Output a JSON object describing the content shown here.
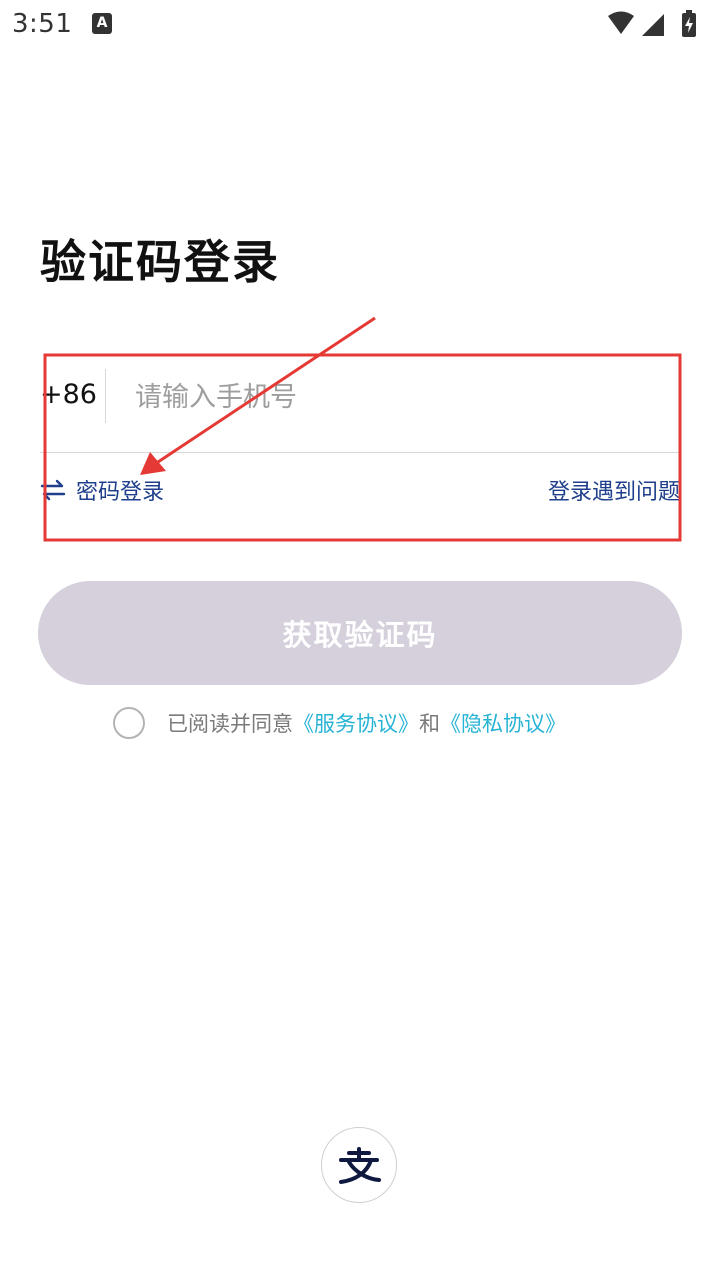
{
  "status_bar": {
    "time": "3:51",
    "notification_letter": "A",
    "icons": [
      "wifi-icon",
      "cellular-signal-icon",
      "battery-charging-icon"
    ]
  },
  "page": {
    "title": "验证码登录"
  },
  "phone": {
    "country_code": "+86",
    "placeholder": "请输入手机号",
    "value": ""
  },
  "links": {
    "switch_icon": "swap-arrows-icon",
    "password_login": "密码登录",
    "login_trouble": "登录遇到问题"
  },
  "actions": {
    "get_code": "获取验证码"
  },
  "agreement": {
    "checked": false,
    "prefix": "已阅读并同意",
    "service_link": "《服务协议》",
    "connector": "和",
    "privacy_link": "《隐私协议》"
  },
  "footer": {
    "logo_icon": "alipay-logo-icon"
  },
  "annotation": {
    "color": "#e53935"
  },
  "colors": {
    "link_blue": "#1f3f8c",
    "agreement_cyan": "#27b3d4",
    "button_disabled": "#d5d0dc"
  }
}
